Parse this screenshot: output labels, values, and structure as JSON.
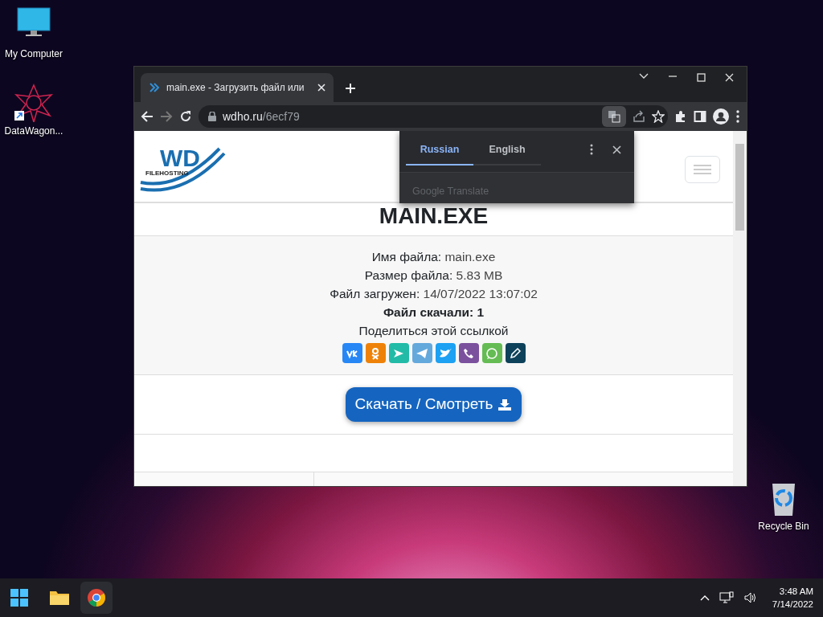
{
  "desktop_icons": [
    {
      "kind": "computer",
      "label": "My Computer"
    },
    {
      "kind": "app",
      "label": "DataWagon..."
    },
    {
      "kind": "bin",
      "label": "Recycle Bin"
    }
  ],
  "browser": {
    "tab": {
      "title": "main.exe - Загрузить файл или"
    },
    "address": {
      "domain": "wdho.ru",
      "path": "/6ecf79"
    },
    "translate_popup": {
      "tabs": [
        {
          "label": "Russian",
          "selected": true
        },
        {
          "label": "English",
          "selected": false
        }
      ],
      "footer": "Google Translate"
    },
    "page": {
      "logo": {
        "text": "WD",
        "subtext": "FILEHOSTING"
      },
      "title": "MAIN.EXE",
      "info": [
        {
          "label": "Имя файла:",
          "value": "main.exe"
        },
        {
          "label": "Размер файла:",
          "value": "5.83 MB"
        },
        {
          "label": "Файл загружен:",
          "value": "14/07/2022 13:07:02"
        }
      ],
      "downloads": "Файл скачали: 1",
      "share_label": "Поделиться этой ссылкой",
      "share_buttons": [
        {
          "kind": "vk",
          "color": "#2787f5"
        },
        {
          "kind": "ok",
          "color": "#ee8208"
        },
        {
          "kind": "send",
          "color": "#22bba7"
        },
        {
          "kind": "telegram",
          "color": "#64a9dc"
        },
        {
          "kind": "twitter",
          "color": "#1da1f2"
        },
        {
          "kind": "viber",
          "color": "#7b519d"
        },
        {
          "kind": "whatsapp",
          "color": "#65bc54"
        },
        {
          "kind": "pencil",
          "color": "#0d425a"
        }
      ],
      "download_button": "Скачать / Смотреть"
    }
  },
  "taskbar": {
    "time": "3:48 AM",
    "date": "7/14/2022"
  }
}
